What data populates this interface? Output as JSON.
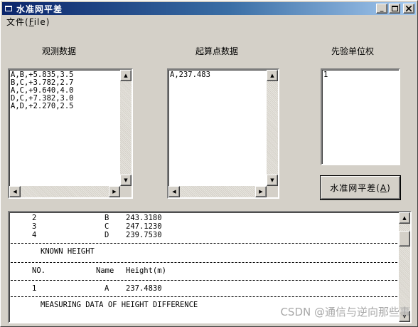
{
  "window": {
    "title": "水准网平差"
  },
  "menu": {
    "file_label": "文件(",
    "file_accel": "F",
    "file_label_end": "ile)"
  },
  "panels": {
    "obs": {
      "title": "观测数据",
      "lines": [
        "A,B,+5.835,3.5",
        "B,C,+3.782,2.7",
        "A,C,+9.640,4.0",
        "D,C,+7.382,3.0",
        "A,D,+2.270,2.5"
      ]
    },
    "start": {
      "title": "起算点数据",
      "lines": [
        "A,237.483"
      ]
    },
    "weight": {
      "title": "先验单位权",
      "value": "1"
    }
  },
  "button": {
    "label": "水准网平差(",
    "accel": "A",
    "label_end": ")"
  },
  "output": {
    "rows_top": [
      {
        "no": "2",
        "name": "B",
        "height": "243.3180"
      },
      {
        "no": "3",
        "name": "C",
        "height": "247.1230"
      },
      {
        "no": "4",
        "name": "D",
        "height": "239.7530"
      }
    ],
    "known_height_title": "KNOWN HEIGHT",
    "header": {
      "no": "NO.",
      "name": "Name",
      "height": "Height(m)"
    },
    "known_rows": [
      {
        "no": "1",
        "name": "A",
        "height": "237.4830"
      }
    ],
    "measuring_title": "MEASURING DATA OF HEIGHT DIFFERENCE"
  },
  "watermark": "CSDN @通信与逆向那些事"
}
